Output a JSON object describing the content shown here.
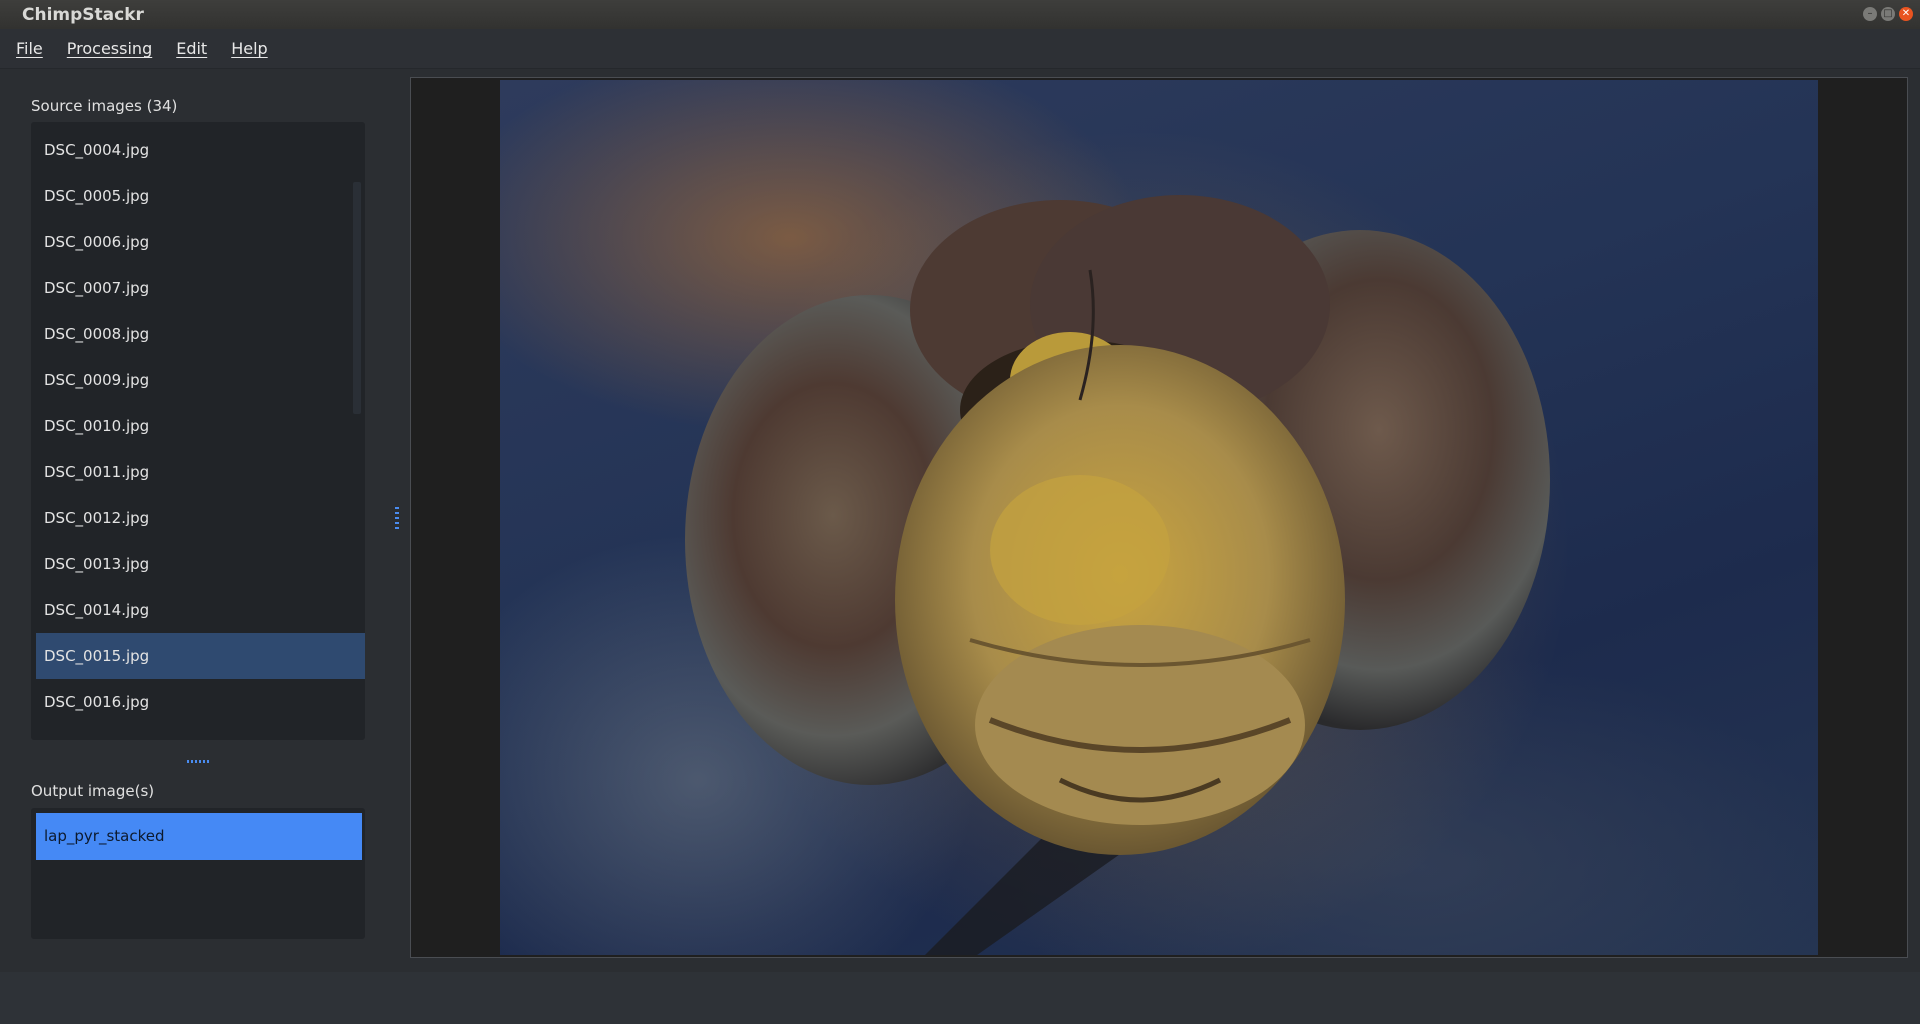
{
  "window": {
    "title": "ChimpStackr"
  },
  "menu": {
    "items": [
      "File",
      "Processing",
      "Edit",
      "Help"
    ]
  },
  "source": {
    "label": "Source images (34)",
    "files": [
      "DSC_0004.jpg",
      "DSC_0005.jpg",
      "DSC_0006.jpg",
      "DSC_0007.jpg",
      "DSC_0008.jpg",
      "DSC_0009.jpg",
      "DSC_0010.jpg",
      "DSC_0011.jpg",
      "DSC_0012.jpg",
      "DSC_0013.jpg",
      "DSC_0014.jpg",
      "DSC_0015.jpg",
      "DSC_0016.jpg"
    ],
    "selected": "DSC_0015.jpg"
  },
  "output": {
    "label": "Output image(s)",
    "items": [
      "lap_pyr_stacked"
    ]
  },
  "viewer": {
    "image_subject": "stacked macro photo of dragonfly head"
  },
  "colors": {
    "accent": "#4589f5",
    "selected_row": "#2f4a70"
  }
}
